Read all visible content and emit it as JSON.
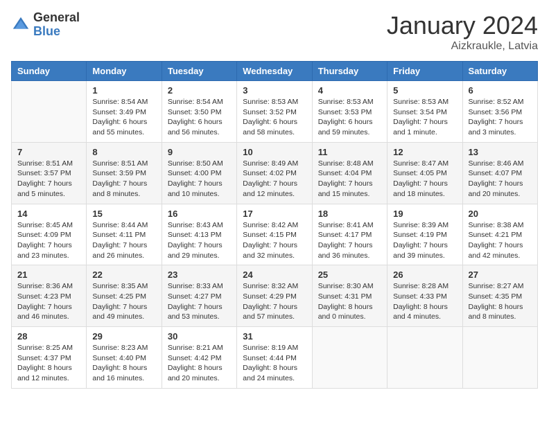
{
  "header": {
    "logo_general": "General",
    "logo_blue": "Blue",
    "main_title": "January 2024",
    "subtitle": "Aizkraukle, Latvia"
  },
  "weekdays": [
    "Sunday",
    "Monday",
    "Tuesday",
    "Wednesday",
    "Thursday",
    "Friday",
    "Saturday"
  ],
  "weeks": [
    [
      {
        "day": "",
        "sunrise": "",
        "sunset": "",
        "daylight": ""
      },
      {
        "day": "1",
        "sunrise": "Sunrise: 8:54 AM",
        "sunset": "Sunset: 3:49 PM",
        "daylight": "Daylight: 6 hours and 55 minutes."
      },
      {
        "day": "2",
        "sunrise": "Sunrise: 8:54 AM",
        "sunset": "Sunset: 3:50 PM",
        "daylight": "Daylight: 6 hours and 56 minutes."
      },
      {
        "day": "3",
        "sunrise": "Sunrise: 8:53 AM",
        "sunset": "Sunset: 3:52 PM",
        "daylight": "Daylight: 6 hours and 58 minutes."
      },
      {
        "day": "4",
        "sunrise": "Sunrise: 8:53 AM",
        "sunset": "Sunset: 3:53 PM",
        "daylight": "Daylight: 6 hours and 59 minutes."
      },
      {
        "day": "5",
        "sunrise": "Sunrise: 8:53 AM",
        "sunset": "Sunset: 3:54 PM",
        "daylight": "Daylight: 7 hours and 1 minute."
      },
      {
        "day": "6",
        "sunrise": "Sunrise: 8:52 AM",
        "sunset": "Sunset: 3:56 PM",
        "daylight": "Daylight: 7 hours and 3 minutes."
      }
    ],
    [
      {
        "day": "7",
        "sunrise": "Sunrise: 8:51 AM",
        "sunset": "Sunset: 3:57 PM",
        "daylight": "Daylight: 7 hours and 5 minutes."
      },
      {
        "day": "8",
        "sunrise": "Sunrise: 8:51 AM",
        "sunset": "Sunset: 3:59 PM",
        "daylight": "Daylight: 7 hours and 8 minutes."
      },
      {
        "day": "9",
        "sunrise": "Sunrise: 8:50 AM",
        "sunset": "Sunset: 4:00 PM",
        "daylight": "Daylight: 7 hours and 10 minutes."
      },
      {
        "day": "10",
        "sunrise": "Sunrise: 8:49 AM",
        "sunset": "Sunset: 4:02 PM",
        "daylight": "Daylight: 7 hours and 12 minutes."
      },
      {
        "day": "11",
        "sunrise": "Sunrise: 8:48 AM",
        "sunset": "Sunset: 4:04 PM",
        "daylight": "Daylight: 7 hours and 15 minutes."
      },
      {
        "day": "12",
        "sunrise": "Sunrise: 8:47 AM",
        "sunset": "Sunset: 4:05 PM",
        "daylight": "Daylight: 7 hours and 18 minutes."
      },
      {
        "day": "13",
        "sunrise": "Sunrise: 8:46 AM",
        "sunset": "Sunset: 4:07 PM",
        "daylight": "Daylight: 7 hours and 20 minutes."
      }
    ],
    [
      {
        "day": "14",
        "sunrise": "Sunrise: 8:45 AM",
        "sunset": "Sunset: 4:09 PM",
        "daylight": "Daylight: 7 hours and 23 minutes."
      },
      {
        "day": "15",
        "sunrise": "Sunrise: 8:44 AM",
        "sunset": "Sunset: 4:11 PM",
        "daylight": "Daylight: 7 hours and 26 minutes."
      },
      {
        "day": "16",
        "sunrise": "Sunrise: 8:43 AM",
        "sunset": "Sunset: 4:13 PM",
        "daylight": "Daylight: 7 hours and 29 minutes."
      },
      {
        "day": "17",
        "sunrise": "Sunrise: 8:42 AM",
        "sunset": "Sunset: 4:15 PM",
        "daylight": "Daylight: 7 hours and 32 minutes."
      },
      {
        "day": "18",
        "sunrise": "Sunrise: 8:41 AM",
        "sunset": "Sunset: 4:17 PM",
        "daylight": "Daylight: 7 hours and 36 minutes."
      },
      {
        "day": "19",
        "sunrise": "Sunrise: 8:39 AM",
        "sunset": "Sunset: 4:19 PM",
        "daylight": "Daylight: 7 hours and 39 minutes."
      },
      {
        "day": "20",
        "sunrise": "Sunrise: 8:38 AM",
        "sunset": "Sunset: 4:21 PM",
        "daylight": "Daylight: 7 hours and 42 minutes."
      }
    ],
    [
      {
        "day": "21",
        "sunrise": "Sunrise: 8:36 AM",
        "sunset": "Sunset: 4:23 PM",
        "daylight": "Daylight: 7 hours and 46 minutes."
      },
      {
        "day": "22",
        "sunrise": "Sunrise: 8:35 AM",
        "sunset": "Sunset: 4:25 PM",
        "daylight": "Daylight: 7 hours and 49 minutes."
      },
      {
        "day": "23",
        "sunrise": "Sunrise: 8:33 AM",
        "sunset": "Sunset: 4:27 PM",
        "daylight": "Daylight: 7 hours and 53 minutes."
      },
      {
        "day": "24",
        "sunrise": "Sunrise: 8:32 AM",
        "sunset": "Sunset: 4:29 PM",
        "daylight": "Daylight: 7 hours and 57 minutes."
      },
      {
        "day": "25",
        "sunrise": "Sunrise: 8:30 AM",
        "sunset": "Sunset: 4:31 PM",
        "daylight": "Daylight: 8 hours and 0 minutes."
      },
      {
        "day": "26",
        "sunrise": "Sunrise: 8:28 AM",
        "sunset": "Sunset: 4:33 PM",
        "daylight": "Daylight: 8 hours and 4 minutes."
      },
      {
        "day": "27",
        "sunrise": "Sunrise: 8:27 AM",
        "sunset": "Sunset: 4:35 PM",
        "daylight": "Daylight: 8 hours and 8 minutes."
      }
    ],
    [
      {
        "day": "28",
        "sunrise": "Sunrise: 8:25 AM",
        "sunset": "Sunset: 4:37 PM",
        "daylight": "Daylight: 8 hours and 12 minutes."
      },
      {
        "day": "29",
        "sunrise": "Sunrise: 8:23 AM",
        "sunset": "Sunset: 4:40 PM",
        "daylight": "Daylight: 8 hours and 16 minutes."
      },
      {
        "day": "30",
        "sunrise": "Sunrise: 8:21 AM",
        "sunset": "Sunset: 4:42 PM",
        "daylight": "Daylight: 8 hours and 20 minutes."
      },
      {
        "day": "31",
        "sunrise": "Sunrise: 8:19 AM",
        "sunset": "Sunset: 4:44 PM",
        "daylight": "Daylight: 8 hours and 24 minutes."
      },
      {
        "day": "",
        "sunrise": "",
        "sunset": "",
        "daylight": ""
      },
      {
        "day": "",
        "sunrise": "",
        "sunset": "",
        "daylight": ""
      },
      {
        "day": "",
        "sunrise": "",
        "sunset": "",
        "daylight": ""
      }
    ]
  ]
}
